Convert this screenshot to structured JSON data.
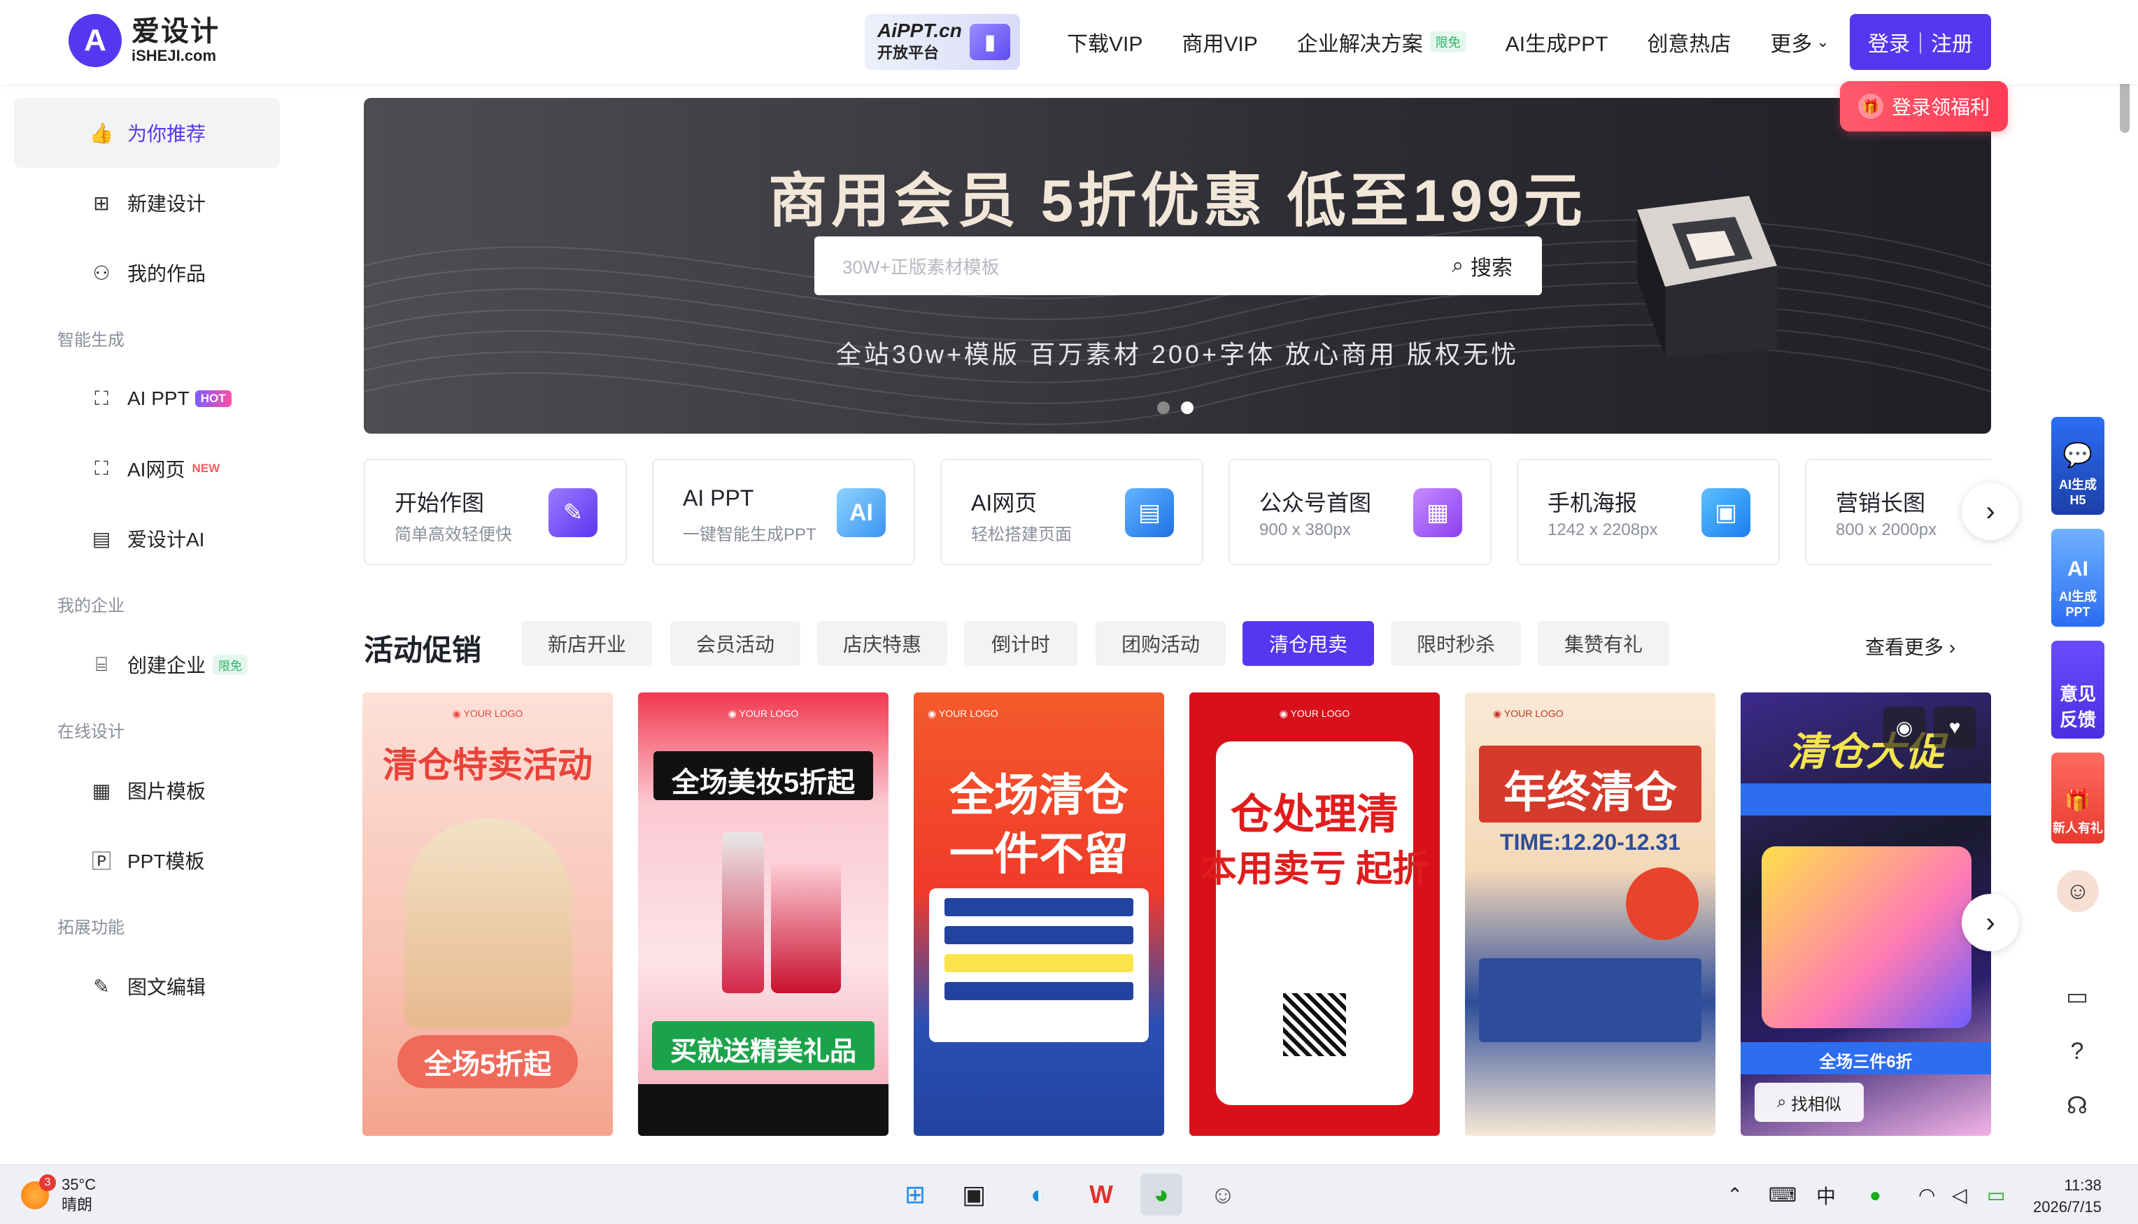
{
  "header": {
    "logo_cn": "爱设计",
    "logo_en": "iSHEJI.com",
    "aippt_line1": "AiPPT.cn",
    "aippt_line2": "开放平台",
    "nav": [
      {
        "label": "下载VIP"
      },
      {
        "label": "商用VIP"
      },
      {
        "label": "企业解决方案",
        "tag": "限免"
      },
      {
        "label": "AI生成PPT"
      },
      {
        "label": "创意热店"
      },
      {
        "label": "更多"
      }
    ],
    "login_label": "登录｜注册",
    "login_perk": "登录领福利"
  },
  "sidebar": {
    "top_items": [
      {
        "label": "为你推荐",
        "icon": "thumbs-up-icon"
      },
      {
        "label": "新建设计",
        "icon": "plus-square-icon"
      },
      {
        "label": "我的作品",
        "icon": "user-icon"
      }
    ],
    "groups": [
      {
        "title": "智能生成",
        "items": [
          {
            "label": "AI PPT",
            "badge": "HOT"
          },
          {
            "label": "AI网页",
            "badge": "NEW"
          },
          {
            "label": "爱设计AI"
          }
        ]
      },
      {
        "title": "我的企业",
        "items": [
          {
            "label": "创建企业",
            "badge": "限免"
          }
        ]
      },
      {
        "title": "在线设计",
        "items": [
          {
            "label": "图片模板"
          },
          {
            "label": "PPT模板"
          }
        ]
      },
      {
        "title": "拓展功能",
        "items": [
          {
            "label": "图文编辑"
          }
        ]
      }
    ]
  },
  "banner": {
    "title": "商用会员 5折优惠 低至199元",
    "search_placeholder": "30W+正版素材模板",
    "search_button": "搜索",
    "subtitle": "全站30w+模版 百万素材 200+字体 放心商用 版权无忧"
  },
  "quick_cards": [
    {
      "title": "开始作图",
      "sub": "简单高效轻便快",
      "color": "#6a4cff",
      "glyph": "✎"
    },
    {
      "title": "AI PPT",
      "sub": "一键智能生成PPT",
      "color": "#4aa8f0",
      "glyph": "AI"
    },
    {
      "title": "AI网页",
      "sub": "轻松搭建页面",
      "color": "#2f8cf5",
      "glyph": "▤"
    },
    {
      "title": "公众号首图",
      "sub": "900 x 380px",
      "color": "#a65cf0",
      "glyph": "▦"
    },
    {
      "title": "手机海报",
      "sub": "1242 x 2208px",
      "color": "#2e9cf5",
      "glyph": "▣"
    },
    {
      "title": "营销长图",
      "sub": "800 x 2000px",
      "color": "#f5a32e",
      "glyph": "▥"
    }
  ],
  "promo": {
    "title": "活动促销",
    "chips": [
      "新店开业",
      "会员活动",
      "店庆特惠",
      "倒计时",
      "团购活动",
      "清仓甩卖",
      "限时秒杀",
      "集赞有礼"
    ],
    "active_chip": "清仓甩卖",
    "more": "查看更多",
    "posters": [
      {
        "headline": "清仓特卖活动",
        "sub": "全场5折起"
      },
      {
        "headline": "全场美妆5折起",
        "sub": "买就送精美礼品"
      },
      {
        "headline": "全场清仓",
        "sub": "一件不留"
      },
      {
        "headline": "仓处理清",
        "sub": "本用卖亏 起折"
      },
      {
        "headline": "年终清仓",
        "sub": "TIME:12.20-12.31"
      },
      {
        "headline": "清仓大促",
        "sub": "全场三件6折"
      }
    ],
    "find_similar": "找相似"
  },
  "float_bar": {
    "tile1": "AI生成H5",
    "tile2": "AI生成PPT",
    "tile3": "意见反馈",
    "tile4": "新人有礼"
  },
  "taskbar": {
    "temp": "35°C",
    "weather": "晴朗",
    "weather_badge": "3",
    "ime": "中",
    "time": "11:38",
    "date": "2026/7/15"
  }
}
